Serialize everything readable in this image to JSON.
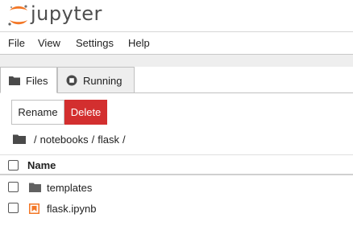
{
  "app": {
    "logo_text": "jupyter"
  },
  "menu": [
    "File",
    "View",
    "Settings",
    "Help"
  ],
  "tabs": [
    {
      "label": "Files",
      "icon": "folder-icon",
      "active": true
    },
    {
      "label": "Running",
      "icon": "stop-circle-icon",
      "active": false
    }
  ],
  "toolbar": {
    "rename_label": "Rename",
    "delete_label": "Delete"
  },
  "breadcrumb": {
    "home_icon": "folder-icon",
    "parts": [
      "notebooks",
      "flask"
    ],
    "separator": "/"
  },
  "list": {
    "header": "Name",
    "items": [
      {
        "name": "templates",
        "type": "folder",
        "icon": "folder-icon"
      },
      {
        "name": "flask.ipynb",
        "type": "notebook",
        "icon": "notebook-icon"
      }
    ]
  },
  "colors": {
    "accent_orange": "#f37726",
    "danger": "#d32f2f",
    "folder": "#616161"
  }
}
